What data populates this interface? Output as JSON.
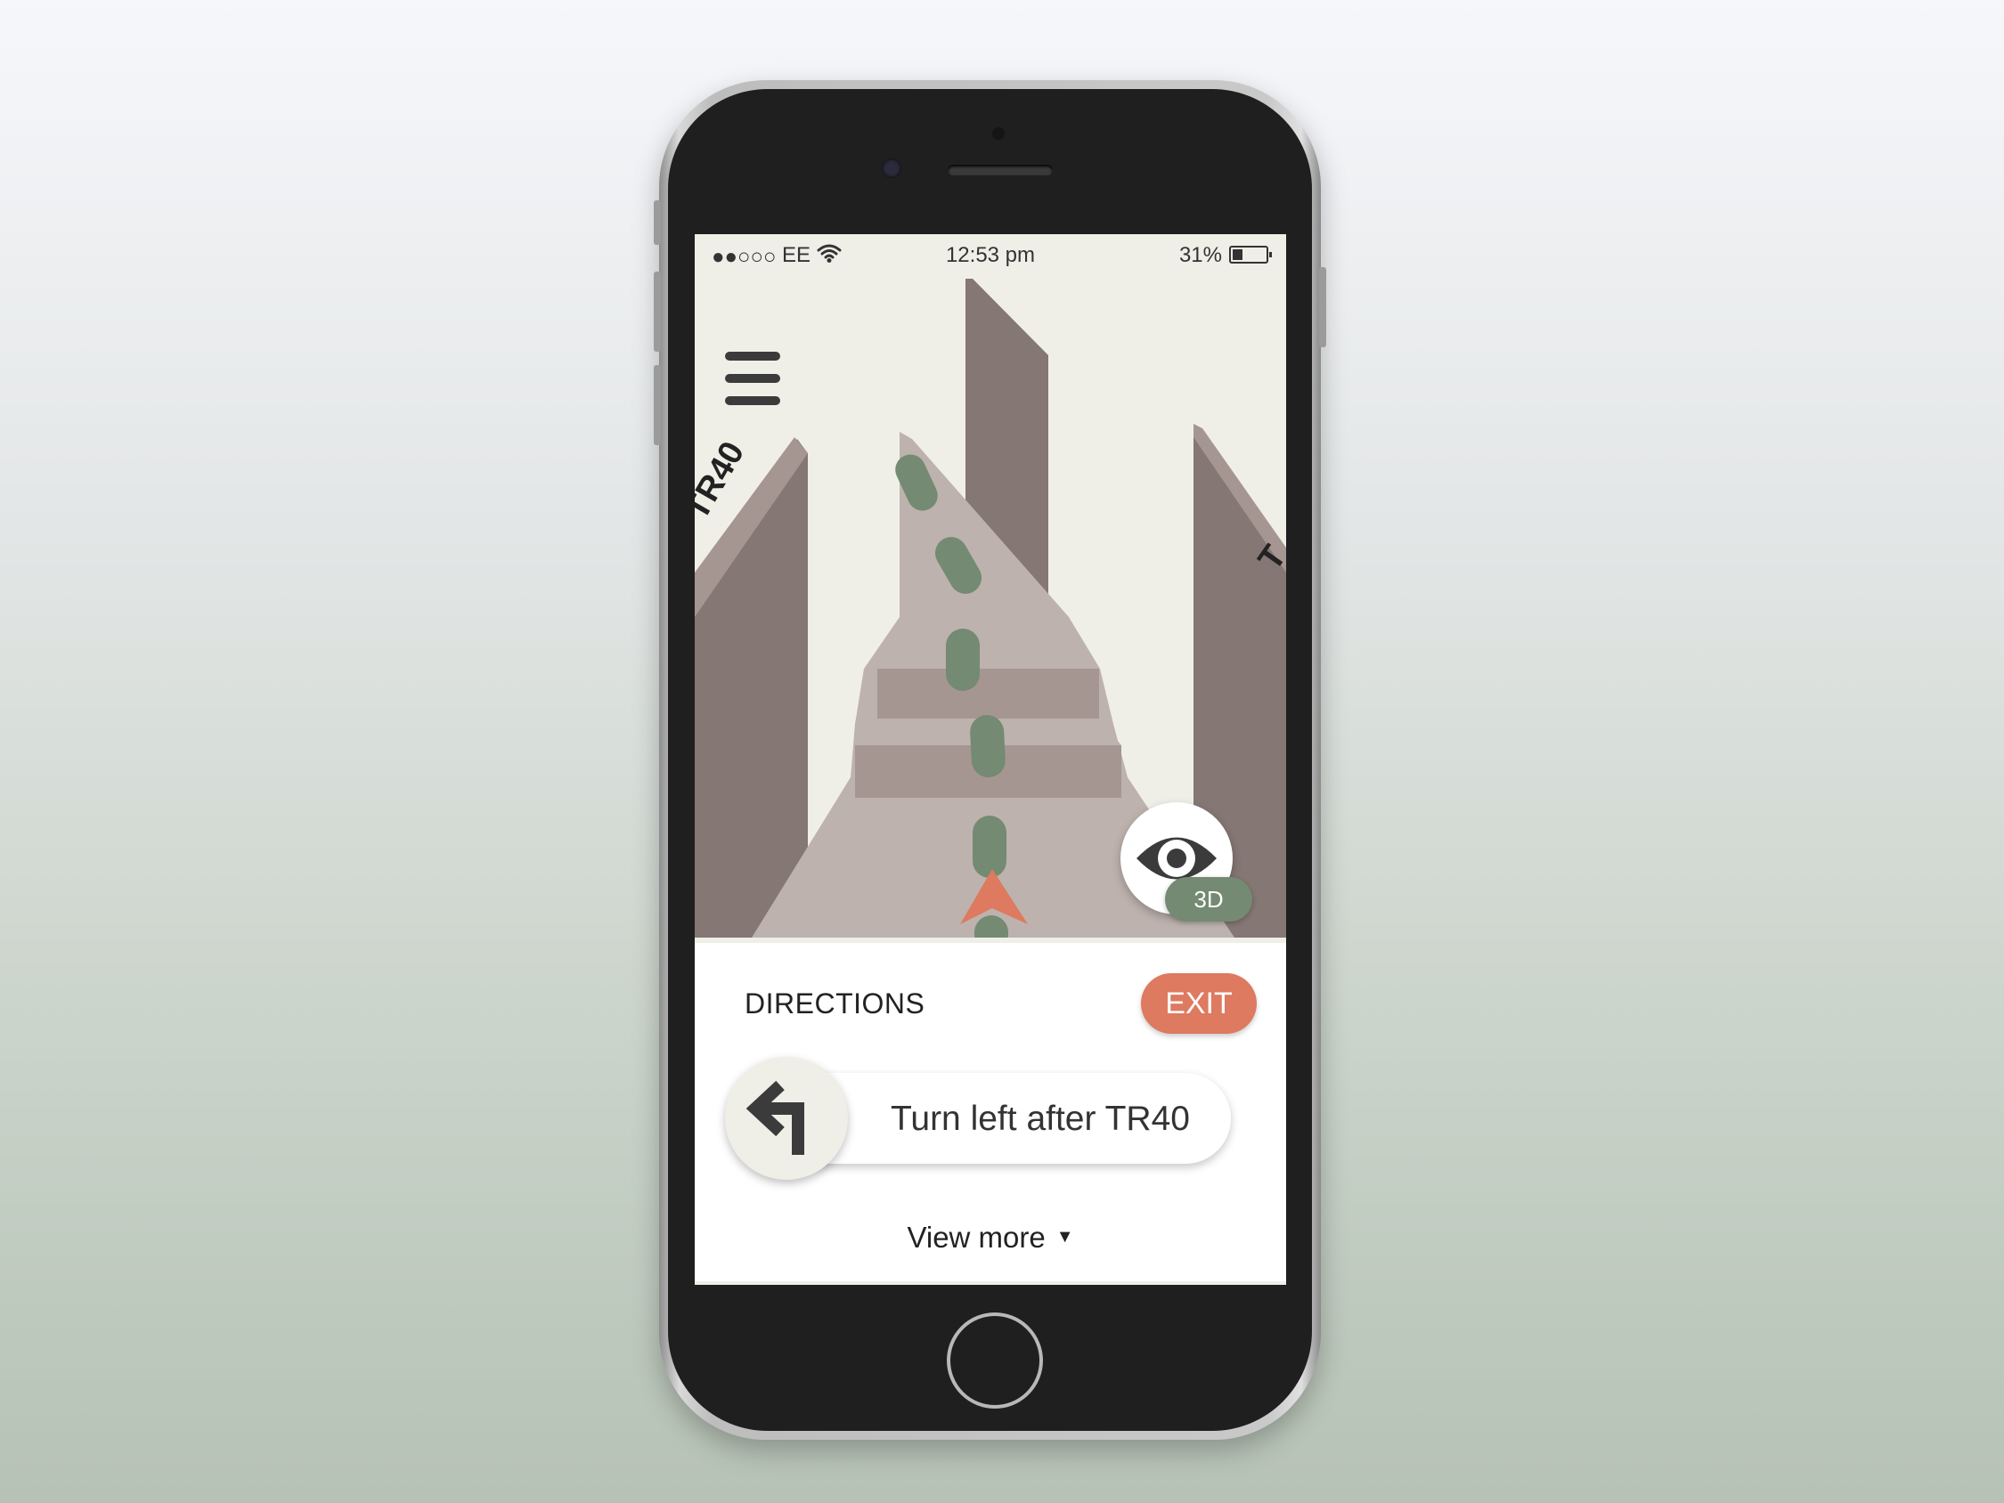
{
  "status_bar": {
    "signal": "●●○○○",
    "carrier": "EE",
    "time": "12:53 pm",
    "battery_percent": "31%",
    "battery_level": 0.31
  },
  "map": {
    "road_labels": [
      "TR40",
      "T"
    ],
    "view_mode": "3D",
    "colors": {
      "sky": "#efefe8",
      "road": "#bdb2ad",
      "building_dark": "#857773",
      "building_light": "#a69692",
      "route": "#748a72",
      "position_marker": "#dd7a5f"
    }
  },
  "menu": {
    "icon": "hamburger-menu-icon"
  },
  "view_toggle": {
    "icon": "eye-icon",
    "label": "3D"
  },
  "directions": {
    "title": "DIRECTIONS",
    "exit_label": "EXIT",
    "instruction_icon": "turn-left-arrow-icon",
    "instruction": "Turn left after TR40",
    "view_more_label": "View more",
    "view_more_icon": "▼"
  }
}
